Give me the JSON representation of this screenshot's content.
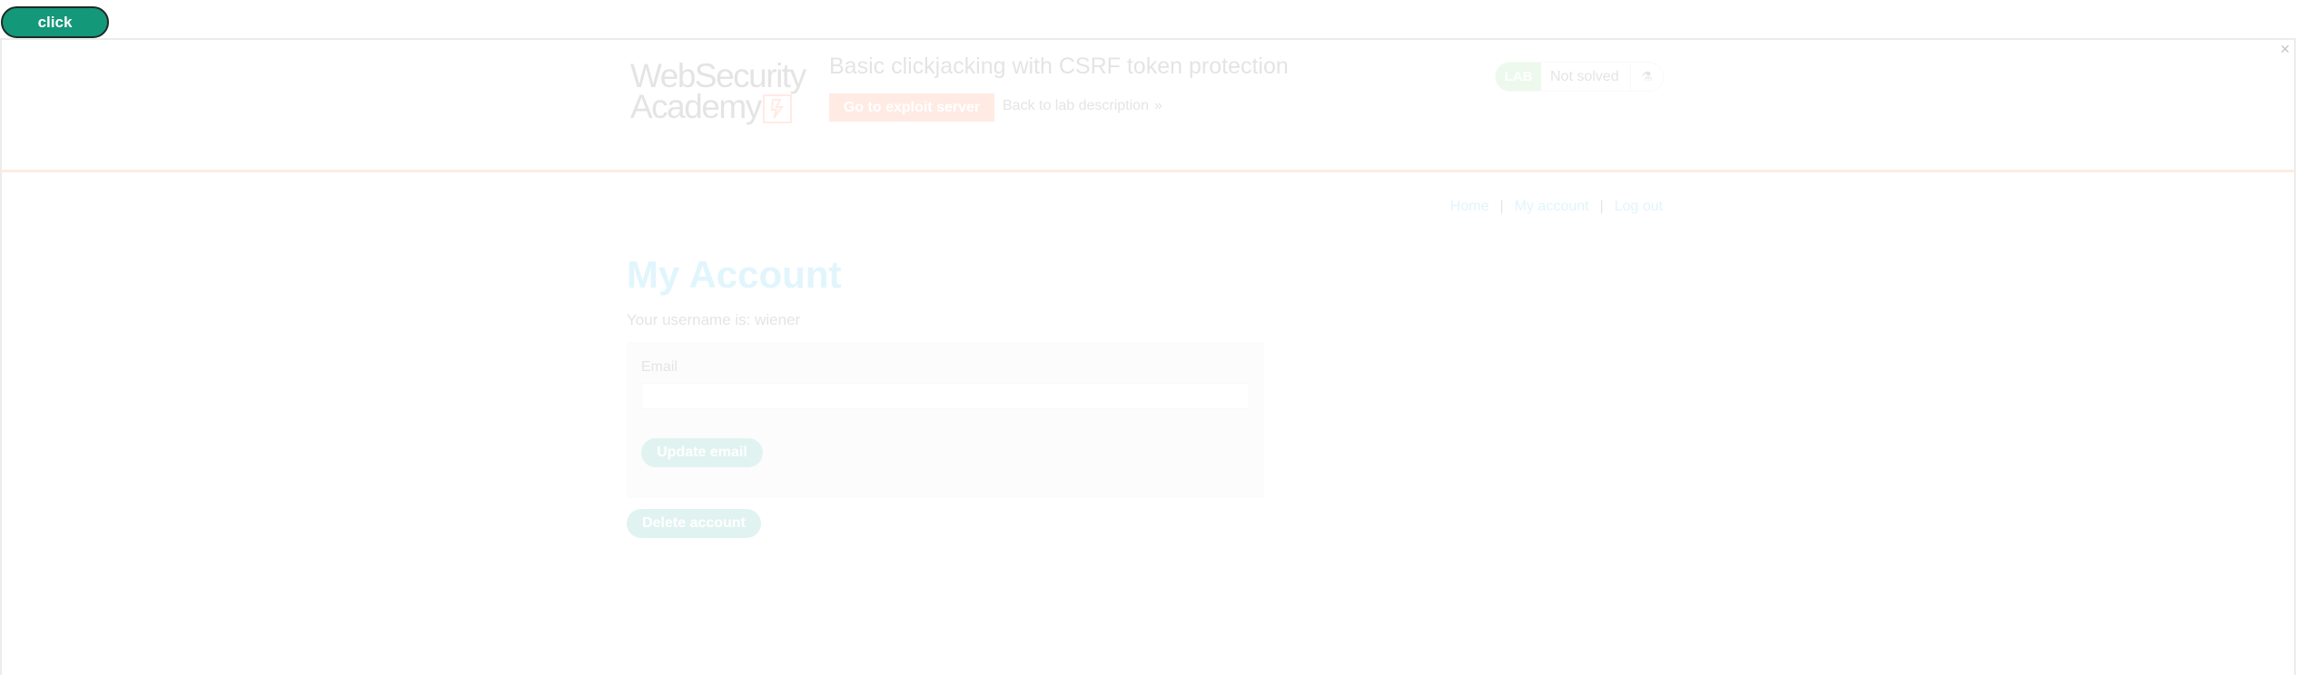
{
  "decoy": {
    "label": "click"
  },
  "frame": {
    "corner_mark": "✕"
  },
  "header": {
    "logo": {
      "line1": "WebSecurity",
      "line2": "Academy"
    },
    "lab_title": "Basic clickjacking with CSRF token protection",
    "exploit_button": "Go to exploit server",
    "back_link": "Back to lab description",
    "back_chevron": "»",
    "lab_badge": "LAB",
    "lab_status": "Not solved",
    "flask_icon": "⚗"
  },
  "nav": {
    "home": "Home",
    "separator": "|",
    "my_account": "My account",
    "log_out": "Log out"
  },
  "account": {
    "title": "My Account",
    "username_line": "Your username is: wiener",
    "email_label": "Email",
    "email_value": "",
    "update_button": "Update email",
    "delete_button": "Delete account"
  },
  "colors": {
    "decoy_bg": "#14987a",
    "academy_orange": "#ff6633",
    "link_blue": "#1ab1e6",
    "button_teal": "#1a9f8c"
  }
}
